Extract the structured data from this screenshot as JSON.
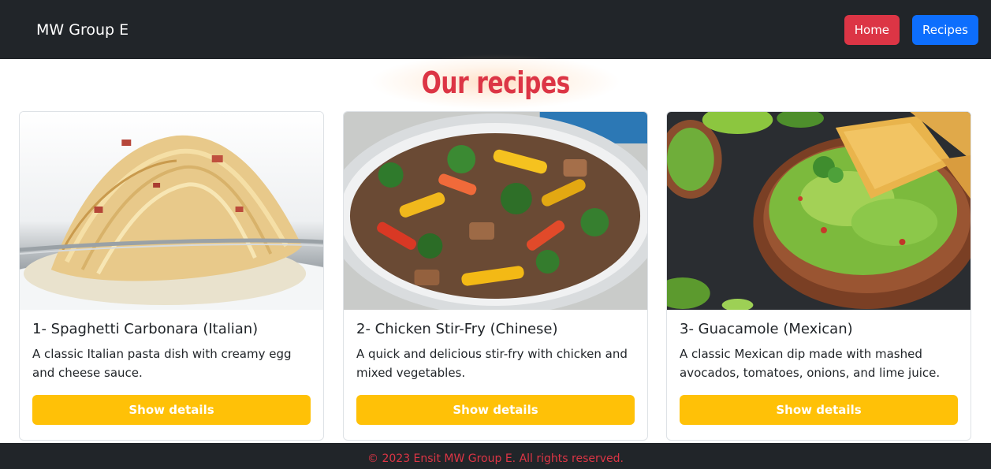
{
  "navbar": {
    "brand": "MW Group E",
    "home_label": "Home",
    "recipes_label": "Recipes"
  },
  "page": {
    "title": "Our recipes"
  },
  "recipes": [
    {
      "title": "1- Spaghetti Carbonara (Italian)",
      "description": "A classic Italian pasta dish with creamy egg and cheese sauce.",
      "button_label": "Show details",
      "image": "spaghetti-carbonara-photo"
    },
    {
      "title": "2- Chicken Stir-Fry (Chinese)",
      "description": "A quick and delicious stir-fry with chicken and mixed vegetables.",
      "button_label": "Show details",
      "image": "chicken-stir-fry-photo"
    },
    {
      "title": "3- Guacamole (Mexican)",
      "description": "A classic Mexican dip made with mashed avocados, tomatoes, onions, and lime juice.",
      "button_label": "Show details",
      "image": "guacamole-photo"
    }
  ],
  "footer": {
    "text": "© 2023 Ensit MW Group E. All rights reserved."
  },
  "colors": {
    "navbar_bg": "#212529",
    "home_button": "#dc3545",
    "recipes_button": "#0d6efd",
    "title": "#dc3545",
    "details_button": "#ffc107",
    "footer_text": "#dc3545"
  }
}
